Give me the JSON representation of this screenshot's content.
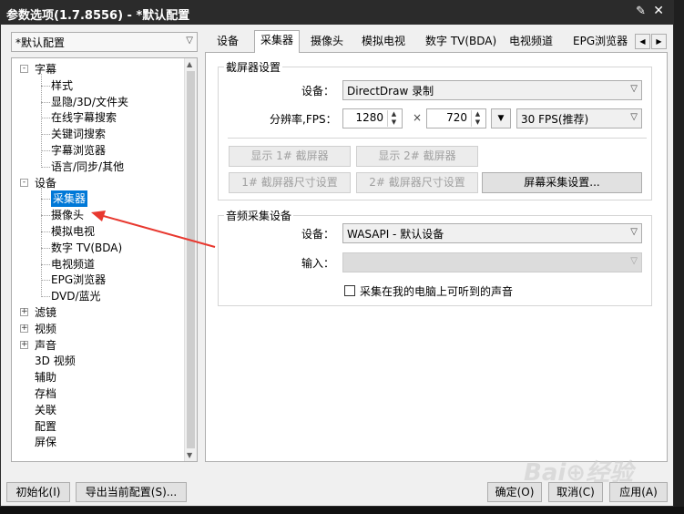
{
  "window": {
    "title": "参数选项(1.7.8556) - *默认配置"
  },
  "profile": {
    "value": "*默认配置"
  },
  "tree": [
    {
      "label": "字幕",
      "level": 0,
      "expander": "-"
    },
    {
      "label": "样式",
      "level": 1
    },
    {
      "label": "显隐/3D/文件夹",
      "level": 1
    },
    {
      "label": "在线字幕搜索",
      "level": 1
    },
    {
      "label": "关键词搜索",
      "level": 1
    },
    {
      "label": "字幕浏览器",
      "level": 1
    },
    {
      "label": "语言/同步/其他",
      "level": 1
    },
    {
      "label": "设备",
      "level": 0,
      "expander": "-"
    },
    {
      "label": "采集器",
      "level": 1,
      "selected": true
    },
    {
      "label": "摄像头",
      "level": 1
    },
    {
      "label": "模拟电视",
      "level": 1
    },
    {
      "label": "数字 TV(BDA)",
      "level": 1
    },
    {
      "label": "电视频道",
      "level": 1
    },
    {
      "label": "EPG浏览器",
      "level": 1
    },
    {
      "label": "DVD/蓝光",
      "level": 1
    },
    {
      "label": "滤镜",
      "level": 0,
      "expander": "+"
    },
    {
      "label": "视频",
      "level": 0,
      "expander": "+"
    },
    {
      "label": "声音",
      "level": 0,
      "expander": "+"
    },
    {
      "label": "3D 视频",
      "level": 0
    },
    {
      "label": "辅助",
      "level": 0
    },
    {
      "label": "存档",
      "level": 0
    },
    {
      "label": "关联",
      "level": 0
    },
    {
      "label": "配置",
      "level": 0
    },
    {
      "label": "屏保",
      "level": 0
    }
  ],
  "tabs": [
    "设备",
    "采集器",
    "摄像头",
    "模拟电视",
    "数字 TV(BDA)",
    "电视频道",
    "EPG浏览器"
  ],
  "screen_capture": {
    "title": "截屏器设置",
    "device_label": "设备：",
    "device_value": "DirectDraw 录制",
    "resolution_label": "分辨率,FPS：",
    "width": "1280",
    "times": "×",
    "height": "720",
    "fps_value": "30 FPS(推荐)",
    "show1": "显示 1# 截屏器",
    "show2": "显示 2# 截屏器",
    "size1": "1# 截屏器尺寸设置",
    "size2": "2# 截屏器尺寸设置",
    "capture_settings": "屏幕采集设置..."
  },
  "audio_capture": {
    "title": "音频采集设备",
    "device_label": "设备：",
    "device_value": "WASAPI - 默认设备",
    "input_label": "输入：",
    "input_value": "",
    "loopback_label": "采集在我的电脑上可听到的声音"
  },
  "footer": {
    "init": "初始化(I)",
    "export": "导出当前配置(S)...",
    "ok": "确定(O)",
    "cancel": "取消(C)",
    "apply": "应用(A)"
  },
  "colors": {
    "selection": "#0078d7",
    "arrow": "#e8382f",
    "titlebar": "#2b2b2b"
  }
}
